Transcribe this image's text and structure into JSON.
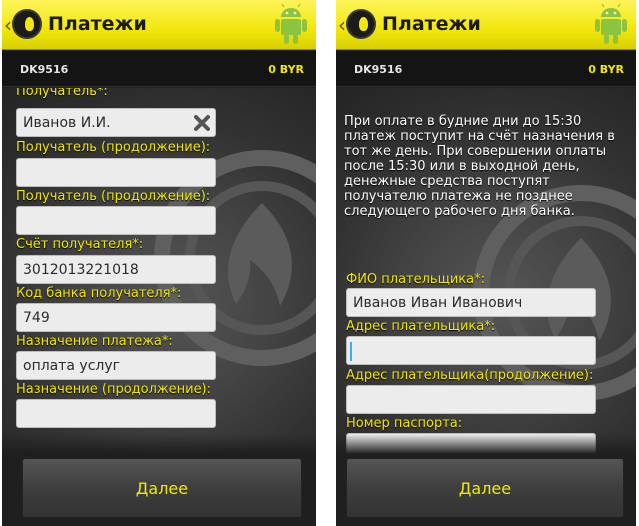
{
  "app": {
    "title": "Платежи",
    "account_code": "DK9516",
    "balance": "0 BYR",
    "accent_color": "#f1e70c"
  },
  "screen_left": {
    "fields": [
      {
        "label": "Получатель*:",
        "value": ""
      },
      {
        "label": "",
        "value": "Иванов И.И."
      },
      {
        "label": "Получатель (продолжение):",
        "value": ""
      },
      {
        "label": "Получатель (продолжение):",
        "value": ""
      },
      {
        "label": "Счёт получателя*:",
        "value": "3012013221018"
      },
      {
        "label": "Код банка получателя*:",
        "value": "749"
      },
      {
        "label": "Назначение платежа*:",
        "value": "оплата услуг"
      },
      {
        "label": "Назначение (продолжение):",
        "value": ""
      }
    ],
    "next_button": "Далее"
  },
  "screen_right": {
    "notice": "При оплате в будние дни до 15:30 платеж поступит на счёт назначения в тот же день. При совершении оплаты после 15:30 или в выходной день, денежные средства поступят получателю платежа не позднее следующего рабочего дня банка.",
    "fields": [
      {
        "label": "ФИО плательщика*:",
        "value": "Иванов Иван Иванович"
      },
      {
        "label": "Адрес плательщика*:",
        "value": ""
      },
      {
        "label": "Адрес плательщика(продолжение):",
        "value": ""
      },
      {
        "label": "Номер паспорта:",
        "value": ""
      }
    ],
    "next_button": "Далее"
  },
  "icons": {
    "back": "chevron-left-icon",
    "logo": "app-logo-icon",
    "android": "android-icon",
    "clear": "clear-x-icon",
    "watermark": "flame-logo-watermark"
  }
}
